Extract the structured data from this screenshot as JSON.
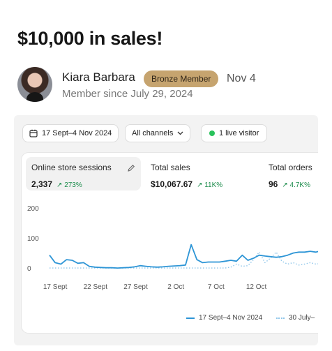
{
  "post": {
    "title": "$10,000 in sales!",
    "author_name": "Kiara Barbara",
    "badge": "Bronze Member",
    "date": "Nov 4",
    "member_since": "Member since July 29, 2024"
  },
  "toolbar": {
    "date_range": "17 Sept–4 Nov 2024",
    "channel": "All channels",
    "live": "1 live visitor"
  },
  "metrics": [
    {
      "label": "Online store sessions",
      "value": "2,337",
      "delta": "↗ 273%"
    },
    {
      "label": "Total sales",
      "value": "$10,067.67",
      "delta": "↗ 11K%"
    },
    {
      "label": "Total orders",
      "value": "96",
      "delta": "↗ 4.7K%"
    }
  ],
  "legend": {
    "current": "17 Sept–4 Nov 2024",
    "previous": "30 July–"
  },
  "colors": {
    "accent": "#2d95d6",
    "previous": "#8fc6ea",
    "positive": "#1c8c4c",
    "badge": "#c6a46f"
  },
  "chart_data": {
    "type": "line",
    "y_ticks": [
      "200",
      "100",
      "0"
    ],
    "x_ticks": [
      "17 Sept",
      "22 Sept",
      "27 Sept",
      "2 Oct",
      "7 Oct",
      "12 Oct"
    ],
    "ylim": [
      0,
      200
    ],
    "x_days": 49,
    "series": [
      {
        "name": "17 Sept–4 Nov 2024",
        "style": "solid",
        "values": [
          45,
          20,
          15,
          30,
          28,
          18,
          20,
          8,
          5,
          4,
          3,
          3,
          2,
          3,
          4,
          6,
          10,
          8,
          6,
          5,
          6,
          8,
          9,
          10,
          12,
          80,
          30,
          20,
          22,
          22,
          22,
          25,
          28,
          25,
          45,
          28,
          35,
          45,
          42,
          40,
          38,
          40,
          45,
          52,
          55,
          55,
          58,
          55,
          60
        ]
      },
      {
        "name": "30 July–",
        "style": "dotted",
        "values": [
          2,
          2,
          2,
          2,
          2,
          2,
          2,
          2,
          2,
          2,
          2,
          2,
          2,
          2,
          2,
          2,
          2,
          2,
          2,
          2,
          2,
          2,
          2,
          2,
          2,
          2,
          2,
          2,
          2,
          2,
          2,
          2,
          5,
          15,
          8,
          10,
          30,
          55,
          20,
          35,
          55,
          25,
          15,
          20,
          12,
          15,
          20,
          15,
          18
        ]
      }
    ]
  }
}
